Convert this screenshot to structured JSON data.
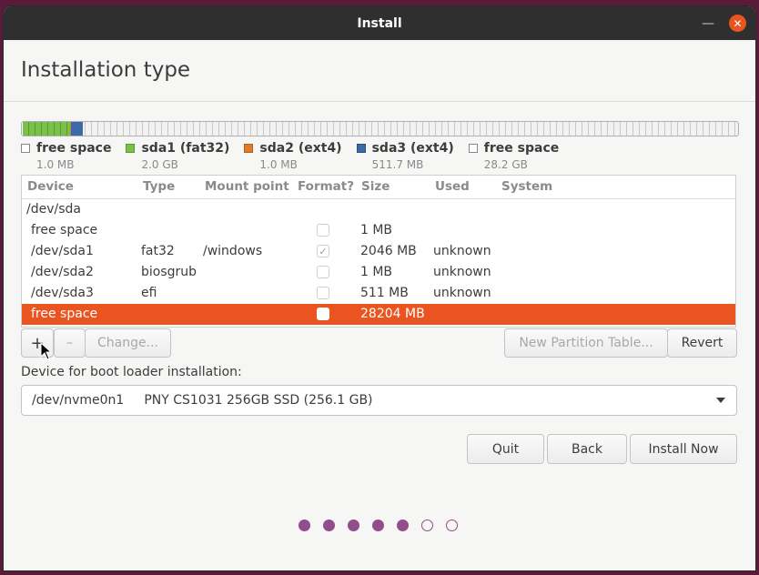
{
  "window": {
    "title": "Install"
  },
  "page_title": "Installation type",
  "legend": [
    {
      "label": "free space",
      "size": "1.0 MB",
      "color": "#ffffff"
    },
    {
      "label": "sda1 (fat32)",
      "size": "2.0 GB",
      "color": "#7ac14a"
    },
    {
      "label": "sda2 (ext4)",
      "size": "1.0 MB",
      "color": "#e07a2e"
    },
    {
      "label": "sda3 (ext4)",
      "size": "511.7 MB",
      "color": "#3c6aa8"
    },
    {
      "label": "free space",
      "size": "28.2 GB",
      "color": "#ffffff"
    }
  ],
  "table": {
    "headers": [
      "Device",
      "Type",
      "Mount point",
      "Format?",
      "Size",
      "Used",
      "System"
    ],
    "rows": [
      {
        "device": "/dev/sda",
        "type": "",
        "mount": "",
        "format": null,
        "size": "",
        "used": "",
        "system": ""
      },
      {
        "device": "free space",
        "type": "",
        "mount": "",
        "format": false,
        "size": "1 MB",
        "used": "",
        "system": ""
      },
      {
        "device": "/dev/sda1",
        "type": "fat32",
        "mount": "/windows",
        "format": true,
        "size": "2046 MB",
        "used": "unknown",
        "system": ""
      },
      {
        "device": "/dev/sda2",
        "type": "biosgrub",
        "mount": "",
        "format": false,
        "size": "1 MB",
        "used": "unknown",
        "system": ""
      },
      {
        "device": "/dev/sda3",
        "type": "efi",
        "mount": "",
        "format": false,
        "size": "511 MB",
        "used": "unknown",
        "system": ""
      },
      {
        "device": "free space",
        "type": "",
        "mount": "",
        "format": false,
        "size": "28204 MB",
        "used": "",
        "system": "",
        "selected": true
      }
    ]
  },
  "toolbar": {
    "add": "+",
    "remove": "–",
    "change": "Change...",
    "new_table": "New Partition Table...",
    "revert": "Revert"
  },
  "boot_loader": {
    "label": "Device for boot loader installation:",
    "device": "/dev/nvme0n1",
    "name": "PNY CS1031 256GB SSD (256.1 GB)"
  },
  "buttons": {
    "quit": "Quit",
    "back": "Back",
    "install": "Install Now"
  },
  "progress": {
    "total": 7,
    "completed": 5
  },
  "colors": {
    "accent": "#e95420",
    "dots": "#924d8b"
  }
}
